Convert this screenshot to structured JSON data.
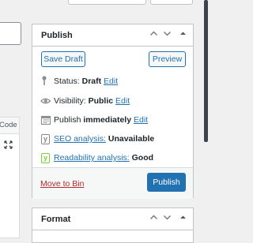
{
  "left": {
    "code_tab": "Code"
  },
  "publish": {
    "title": "Publish",
    "save_draft": "Save Draft",
    "preview": "Preview",
    "status_label": "Status:",
    "status_value": "Draft",
    "visibility_label": "Visibility:",
    "visibility_value": "Public",
    "publish_label": "Publish",
    "publish_value": "immediately",
    "edit": "Edit",
    "seo_label": "SEO analysis:",
    "seo_value": "Unavailable",
    "readability_label": "Readability analysis:",
    "readability_value": "Good",
    "move_to_bin": "Move to Bin",
    "publish_button": "Publish"
  },
  "format": {
    "title": "Format"
  },
  "colors": {
    "accent": "#2271b1",
    "danger": "#b32d2e",
    "good": "#7ad03a"
  }
}
